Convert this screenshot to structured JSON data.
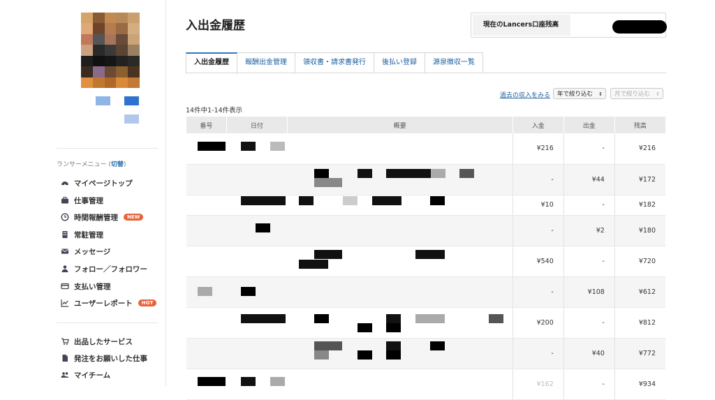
{
  "sidebar": {
    "menu_header": "ランサーメニュー (",
    "menu_toggle": "切替",
    "menu_header_end": ")",
    "items": [
      {
        "label": "マイページトップ",
        "icon": "dashboard-icon"
      },
      {
        "label": "仕事管理",
        "icon": "briefcase-icon"
      },
      {
        "label": "時間報酬管理",
        "icon": "clock-icon",
        "badge": "NEW"
      },
      {
        "label": "常駐管理",
        "icon": "building-icon"
      },
      {
        "label": "メッセージ",
        "icon": "envelope-icon"
      },
      {
        "label": "フォロー／フォロワー",
        "icon": "person-icon"
      },
      {
        "label": "支払い管理",
        "icon": "card-icon"
      },
      {
        "label": "ユーザーレポート",
        "icon": "chart-icon",
        "badge": "HOT"
      }
    ],
    "items2": [
      {
        "label": "出品したサービス",
        "icon": "cart-icon"
      },
      {
        "label": "発注をお願いした仕事",
        "icon": "document-icon"
      },
      {
        "label": "マイチーム",
        "icon": "team-icon"
      }
    ]
  },
  "header": {
    "title": "入出金履歴",
    "balance_label": "現在のLancers口座残高"
  },
  "tabs": [
    {
      "label": "入出金履歴",
      "active": true
    },
    {
      "label": "報酬出金管理"
    },
    {
      "label": "領収書・請求書発行"
    },
    {
      "label": "後払い登録"
    },
    {
      "label": "源泉徴収一覧"
    }
  ],
  "filters": {
    "past_link": "過去の収入をみる",
    "year_select": "年で絞り込む",
    "month_select": "月で絞り込む"
  },
  "count_text": "14件中1-14件表示",
  "table": {
    "columns": [
      "番号",
      "日付",
      "概要",
      "入金",
      "出金",
      "残高"
    ],
    "rows": [
      {
        "in": "¥216",
        "out": "-",
        "bal": "¥216"
      },
      {
        "in": "-",
        "out": "¥44",
        "bal": "¥172"
      },
      {
        "in": "¥10",
        "out": "-",
        "bal": "¥182"
      },
      {
        "in": "-",
        "out": "¥2",
        "bal": "¥180"
      },
      {
        "in": "¥540",
        "out": "-",
        "bal": "¥720"
      },
      {
        "in": "-",
        "out": "¥108",
        "bal": "¥612"
      },
      {
        "in": "¥200",
        "out": "-",
        "bal": "¥812"
      },
      {
        "in": "-",
        "out": "¥40",
        "bal": "¥772"
      },
      {
        "in": "¥162",
        "out": "-",
        "bal": "¥934"
      }
    ]
  },
  "colors": {
    "link": "#1c5fa0",
    "tab_accent": "#2e78c4",
    "badge": "#e8633a"
  }
}
